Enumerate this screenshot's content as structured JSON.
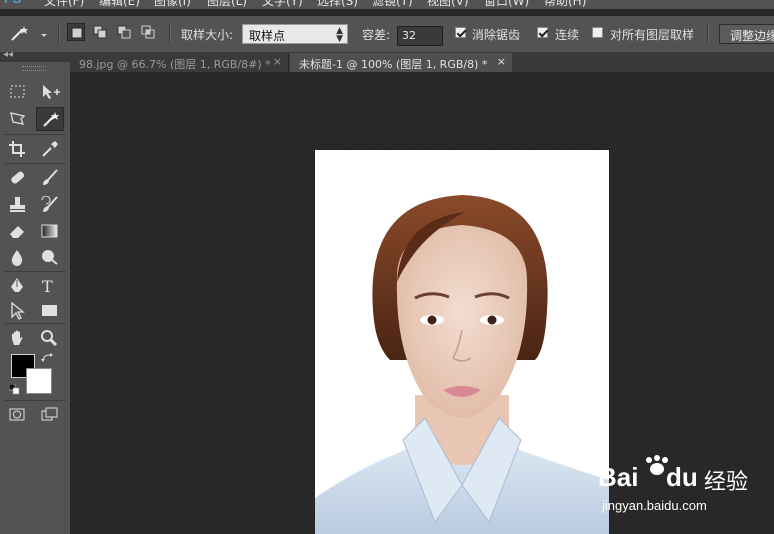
{
  "app": {
    "logo": "PS"
  },
  "menu": [
    "文件(F)",
    "编辑(E)",
    "图像(I)",
    "图层(L)",
    "文字(Y)",
    "选择(S)",
    "滤镜(T)",
    "视图(V)",
    "窗口(W)",
    "帮助(H)"
  ],
  "options": {
    "sample_size_label": "取样大小:",
    "sample_size_value": "取样点",
    "tolerance_label": "容差:",
    "tolerance_value": "32",
    "antialias_label": "消除锯齿",
    "antialias_checked": true,
    "contiguous_label": "连续",
    "contiguous_checked": true,
    "all_layers_label": "对所有图层取样",
    "all_layers_checked": false,
    "refine_edge_label": "调整边缘"
  },
  "toolbox": {
    "collapse": "◂◂"
  },
  "tabs": [
    {
      "label": "98.jpg @ 66.7% (图层 1, RGB/8#) *",
      "close": "×",
      "active": false
    },
    {
      "label": "未标题-1 @ 100% (图层 1, RGB/8) *",
      "close": "×",
      "active": true
    }
  ],
  "colors": {
    "foreground": "#000000",
    "background": "#ffffff",
    "ui_panel": "#535353",
    "canvas_bg": "#282828"
  },
  "watermark": {
    "brand": "Bai",
    "brand2": "du",
    "cn": "经验",
    "url": "jingyan.baidu.com"
  }
}
